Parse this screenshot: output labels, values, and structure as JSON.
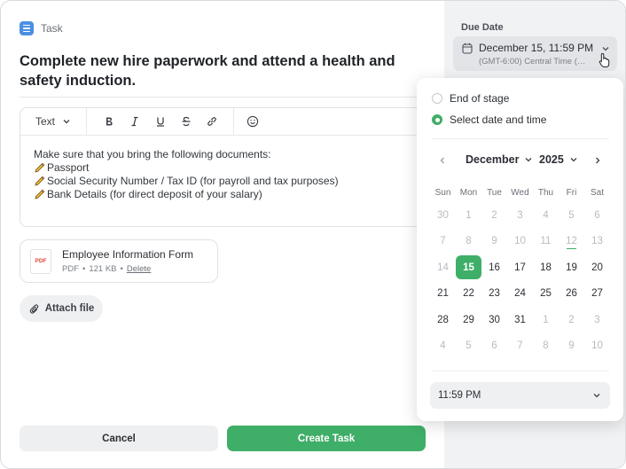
{
  "task": {
    "type_label": "Task",
    "title": "Complete new hire paperwork and attend a health and safety induction."
  },
  "editor": {
    "text_style": "Text",
    "icons": [
      "bold-icon",
      "italic-icon",
      "underline-icon",
      "strikethrough-icon",
      "link-icon",
      "emoji-icon"
    ],
    "intro": "Make sure that you bring the following documents:",
    "items": [
      "Passport",
      "Social Security Number / Tax ID (for payroll and tax purposes)",
      "Bank Details (for direct deposit of your salary)"
    ]
  },
  "attachment": {
    "file_type": "PDF",
    "name": "Employee Information Form",
    "type_text": "PDF",
    "size": "121 KB",
    "delete_label": "Delete"
  },
  "attach_button": "Attach file",
  "actions": {
    "cancel": "Cancel",
    "create": "Create Task"
  },
  "due_date": {
    "label": "Due Date",
    "value": "December 15, 11:59 PM",
    "timezone": "(GMT-6:00) Central Time (M..."
  },
  "picker": {
    "options": [
      "End of stage",
      "Select date and time"
    ],
    "selected_option": "Select date and time",
    "month": "December",
    "year": "2025",
    "weekdays": [
      "Sun",
      "Mon",
      "Tue",
      "Wed",
      "Thu",
      "Fri",
      "Sat"
    ],
    "days": [
      {
        "d": "30",
        "muted": true
      },
      {
        "d": "1",
        "muted": true
      },
      {
        "d": "2",
        "muted": true
      },
      {
        "d": "3",
        "muted": true
      },
      {
        "d": "4",
        "muted": true
      },
      {
        "d": "5",
        "muted": true
      },
      {
        "d": "6",
        "muted": true
      },
      {
        "d": "7",
        "muted": true
      },
      {
        "d": "8",
        "muted": true
      },
      {
        "d": "9",
        "muted": true
      },
      {
        "d": "10",
        "muted": true
      },
      {
        "d": "11",
        "muted": true
      },
      {
        "d": "12",
        "muted": true,
        "today": true
      },
      {
        "d": "13",
        "muted": true
      },
      {
        "d": "14",
        "muted": true
      },
      {
        "d": "15",
        "selected": true
      },
      {
        "d": "16"
      },
      {
        "d": "17"
      },
      {
        "d": "18"
      },
      {
        "d": "19"
      },
      {
        "d": "20"
      },
      {
        "d": "21"
      },
      {
        "d": "22"
      },
      {
        "d": "23"
      },
      {
        "d": "24"
      },
      {
        "d": "25"
      },
      {
        "d": "26"
      },
      {
        "d": "27"
      },
      {
        "d": "28"
      },
      {
        "d": "29"
      },
      {
        "d": "30"
      },
      {
        "d": "31"
      },
      {
        "d": "1",
        "muted": true
      },
      {
        "d": "2",
        "muted": true
      },
      {
        "d": "3",
        "muted": true
      },
      {
        "d": "4",
        "muted": true
      },
      {
        "d": "5",
        "muted": true
      },
      {
        "d": "6",
        "muted": true
      },
      {
        "d": "7",
        "muted": true
      },
      {
        "d": "8",
        "muted": true
      },
      {
        "d": "9",
        "muted": true
      },
      {
        "d": "10",
        "muted": true
      }
    ],
    "time": "11:59 PM"
  },
  "colors": {
    "accent": "#3fae68",
    "task_icon": "#4a90e2",
    "pdf_red": "#e0483c"
  }
}
